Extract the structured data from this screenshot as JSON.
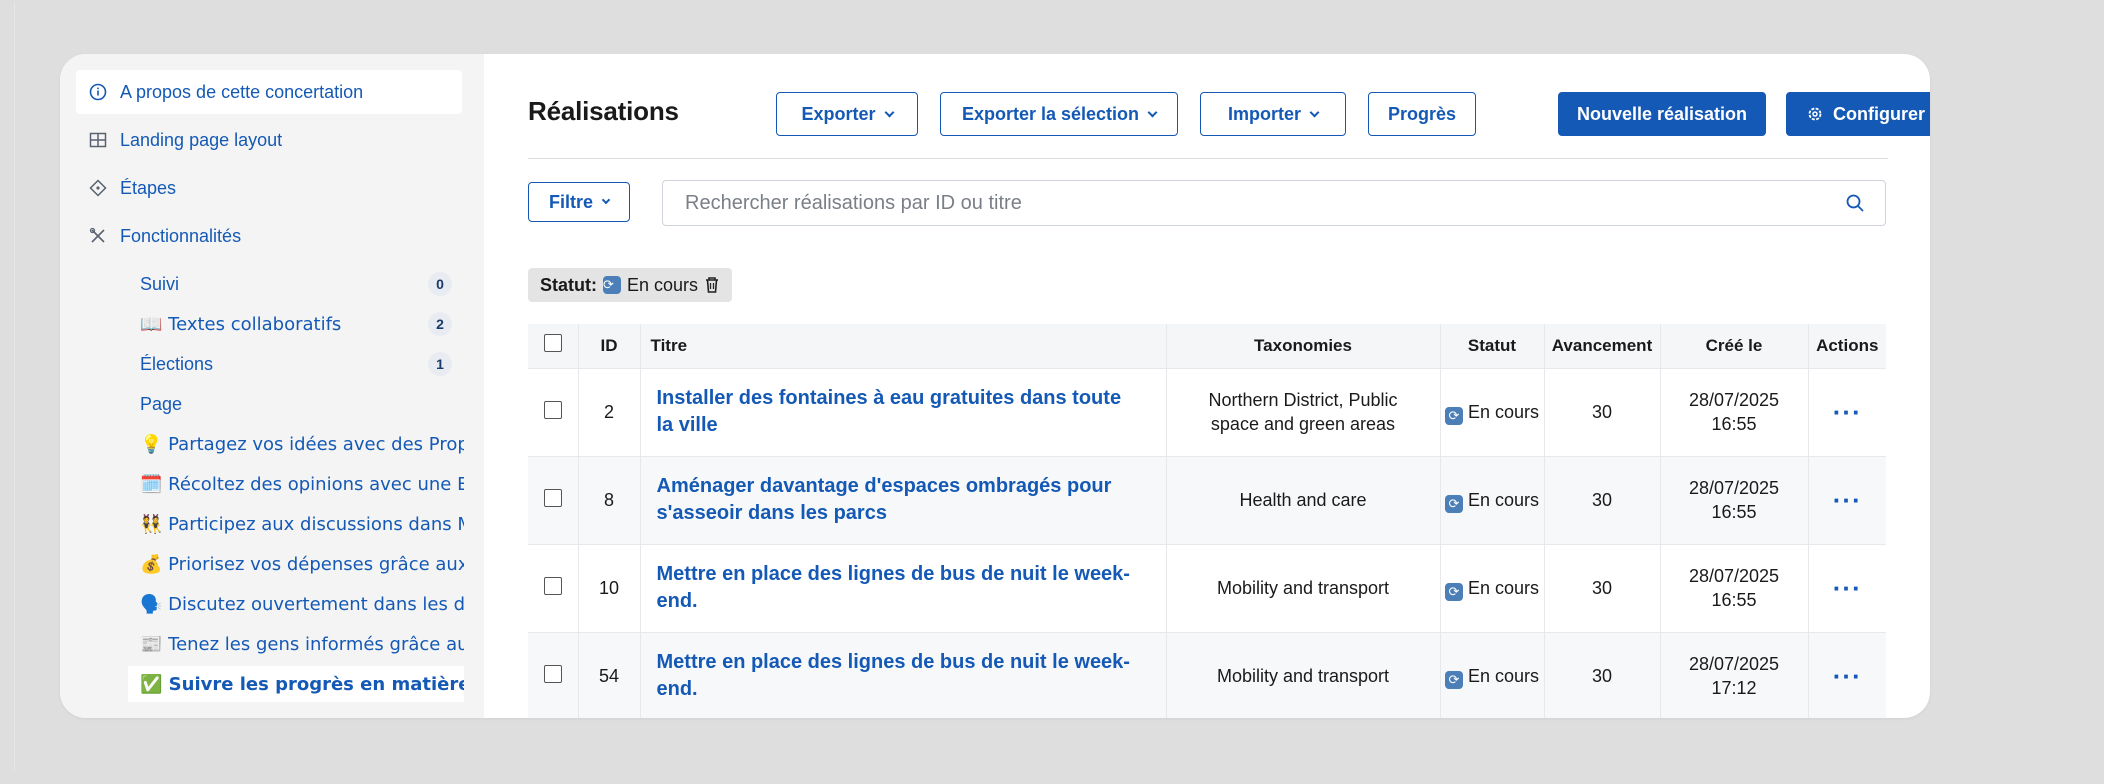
{
  "sidebar": {
    "nav": [
      {
        "label": "A propos de cette concertation",
        "icon": "info-icon"
      },
      {
        "label": "Landing page layout",
        "icon": "layout-icon"
      },
      {
        "label": "Étapes",
        "icon": "steps-icon"
      },
      {
        "label": "Fonctionnalités",
        "icon": "tools-icon"
      }
    ],
    "features": [
      {
        "label": "Suivi",
        "count": "0"
      },
      {
        "label": "📖 Textes collaboratifs",
        "count": "2"
      },
      {
        "label": "Élections",
        "count": "1"
      },
      {
        "label": "Page"
      },
      {
        "label": "💡 Partagez vos idées avec des Propositic"
      },
      {
        "label": "🗓️ Récoltez des opinions avec une Enquê"
      },
      {
        "label": "👯 Participez aux discussions dans Meetir"
      },
      {
        "label": "💰 Priorisez vos dépenses grâce aux budg"
      },
      {
        "label": "🗣️ Discutez ouvertement dans les débats"
      },
      {
        "label": "📰 Tenez les gens informés grâce au blog"
      },
      {
        "label": "✅ Suivre les progrès en matière de resp"
      }
    ]
  },
  "header": {
    "title": "Réalisations",
    "export_label": "Exporter",
    "export_selection_label": "Exporter la sélection",
    "import_label": "Importer",
    "progress_label": "Progrès",
    "new_label": "Nouvelle réalisation",
    "configure_label": "Configurer"
  },
  "filter": {
    "label": "Filtre",
    "search_placeholder": "Rechercher réalisations par ID ou titre",
    "chip_key": "Statut:",
    "chip_value": "En cours"
  },
  "table": {
    "headers": [
      "ID",
      "Titre",
      "Taxonomies",
      "Statut",
      "Avancement",
      "Créé le",
      "Actions"
    ],
    "rows": [
      {
        "id": "2",
        "title": "Installer des fontaines à eau gratuites dans toute la ville",
        "taxonomies": "Northern District, Public space and green areas",
        "status": "En cours",
        "progress": "30",
        "date": "28/07/2025",
        "time": "16:55"
      },
      {
        "id": "8",
        "title": "Aménager davantage d'espaces ombragés pour s'asseoir dans les parcs",
        "taxonomies": "Health and care",
        "status": "En cours",
        "progress": "30",
        "date": "28/07/2025",
        "time": "16:55"
      },
      {
        "id": "10",
        "title": "Mettre en place des lignes de bus de nuit le week-end.",
        "taxonomies": "Mobility and transport",
        "status": "En cours",
        "progress": "30",
        "date": "28/07/2025",
        "time": "16:55"
      },
      {
        "id": "54",
        "title": "Mettre en place des lignes de bus de nuit le week-end.",
        "taxonomies": "Mobility and transport",
        "status": "En cours",
        "progress": "30",
        "date": "28/07/2025",
        "time": "17:12"
      }
    ]
  },
  "colors": {
    "accent": "#1459b5",
    "sidebar_bg": "#f4f4f4",
    "page_bg": "#dedede"
  }
}
